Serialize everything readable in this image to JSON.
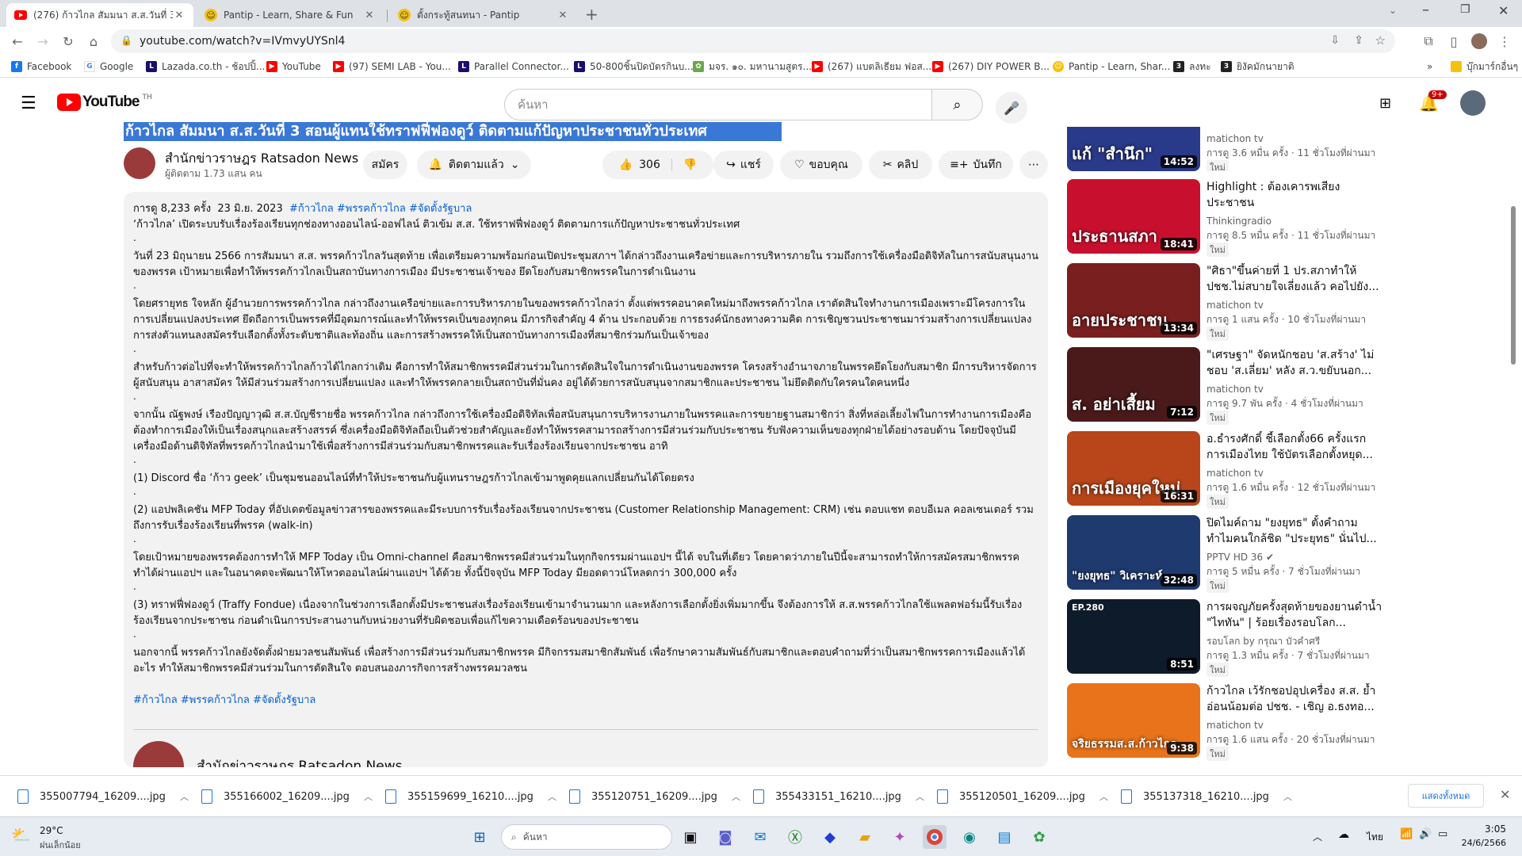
{
  "browser": {
    "tabs": [
      {
        "title": "(276) ก้าวไกล สัมมนา ส.ส.วันที่ 3 สอน",
        "active": true
      },
      {
        "title": "Pantip - Learn, Share & Fun",
        "active": false
      },
      {
        "title": "ตั้งกระทู้สนทนา - Pantip",
        "active": false
      }
    ],
    "new_tab": "+",
    "url": "youtube.com/watch?v=IVmvyUYSnl4",
    "bookmarks": [
      "Facebook",
      "Google",
      "Lazada.co.th - ช้อปปิ้...",
      "YouTube",
      "(97) SEMI LAB - You...",
      "Parallel Connector...",
      "50-800ชิ้นปิดบัตรกินบ...",
      "มจร. ๑๐. มหานามสูตร...",
      "(267) แบตลิเธียม ฟอส...",
      "(267) DIY POWER B...",
      "Pantip - Learn, Shar...",
      "ลงทะ",
      "ยิงัคมักนายาติ"
    ],
    "bookmarks_more": "»",
    "bookmarks_folder": "บุ๊กมาร์กอื่นๆ"
  },
  "youtube": {
    "logo": "YouTube",
    "logo_country": "TH",
    "search_placeholder": "ค้นหา",
    "notif_count": "9+"
  },
  "video": {
    "title": "ก้าวไกล สัมมนา ส.ส.วันที่ 3 สอนผู้แทนใช้ทราฟฟี่ฟองดูว์ ติดตามแก้ปัญหาประชาชนทั่วประเทศ",
    "channel": "สำนักข่าวราษฎร Ratsadon News",
    "subscribers": "ผู้ติดตาม 1.73 แสน คน",
    "join_label": "สมัคร",
    "subscribed_label": "ติดตามแล้ว",
    "likes": "306",
    "share_label": "แชร์",
    "thanks_label": "ขอบคุณ",
    "clip_label": "คลิป",
    "save_label": "บันทึก"
  },
  "description": {
    "views": "การดู 8,233 ครั้ง",
    "date": "23 มิ.ย. 2023",
    "hashtags_top": "#ก้าวไกล #พรรคก้าวไกล #จัดตั้งรัฐบาล",
    "paragraphs": [
      "‘ก้าวไกล’ เปิดระบบรับเรื่องร้องเรียนทุกช่องทางออนไลน์-ออฟไลน์ ติวเข้ม ส.ส. ใช้ทราฟฟี่ฟองดูว์ ติดตามการแก้ปัญหาประชาชนทั่วประเทศ",
      "วันที่ 23 มิถุนายน 2566 การสัมมนา ส.ส. พรรคก้าวไกลวันสุดท้าย เพื่อเตรียมความพร้อมก่อนเปิดประชุมสภาฯ ได้กล่าวถึงงานเครือข่ายและการบริหารภายใน รวมถึงการใช้เครื่องมือดิจิทัลในการสนับสนุนงานของพรรค เป้าหมายเพื่อทำให้พรรคก้าวไกลเป็นสถาบันทางการเมือง มีประชาชนเจ้าของ ยึดโยงกับสมาชิกพรรคในการดำเนินงาน",
      "โดยศรายุทธ ใจหลัก ผู้อำนวยการพรรคก้าวไกล กล่าวถึงงานเครือข่ายและการบริหารภายในของพรรคก้าวไกลว่า ตั้งแต่พรรคอนาคตใหม่มาถึงพรรคก้าวไกล เราตัดสินใจทำงานการเมืองเพราะมีโครงการในการเปลี่ยนแปลงประเทศ ยึดถือการเป็นพรรคที่มีอุดมการณ์และทำให้พรรคเป็นของทุกคน มีภารกิจสำคัญ 4 ด้าน ประกอบด้วย การธรงค์นักธงทางความคิด การเชิญชวนประชาชนมาร่วมสร้างการเปลี่ยนแปลง การส่งตัวแทนลงสมัครรับเลือกตั้งทั้งระดับชาติและท้องถิ่น และการสร้างพรรคให้เป็นสถาบันทางการเมืองที่สมาชิกร่วมกันเป็นเจ้าของ",
      "สำหรับก้าวต่อไปที่จะทำให้พรรคก้าวไกลก้าวได้ไกลกว่าเดิม คือการทำให้สมาชิกพรรคมีส่วนร่วมในการตัดสินใจในการดำเนินงานของพรรค โครงสร้างอำนาจภายในพรรคยึดโยงกับสมาชิก มีการบริหารจัดการผู้สนับสนุน อาสาสมัคร ให้มีส่วนร่วมสร้างการเปลี่ยนแปลง และทำให้พรรคกลายเป็นสถาบันที่มั่นคง อยู่ได้ด้วยการสนับสนุนจากสมาชิกและประชาชน ไม่ยึดติดกับใครคนใดคนหนึ่ง",
      "จากนั้น ณัฐพงษ์ เรืองปัญญาวุฒิ ส.ส.บัญชีรายชื่อ พรรคก้าวไกล กล่าวถึงการใช้เครื่องมือดิจิทัลเพื่อสนับสนุนการบริหารงานภายในพรรคและการขยายฐานสมาชิกว่า สิ่งที่หล่อเลี้ยงไฟในการทำงานการเมืองคือต้องทำการเมืองให้เป็นเรื่องสนุกและสร้างสรรค์ ซึ่งเครื่องมือดิจิทัลถือเป็นตัวช่วยสำคัญและยังทำให้พรรคสามารถสร้างการมีส่วนร่วมกับประชาชน รับฟังความเห็นของทุกฝ่ายได้อย่างรอบด้าน โดยปัจจุบันมีเครื่องมือด้านดิจิทัลที่พรรคก้าวไกลนำมาใช้เพื่อสร้างการมีส่วนร่วมกับสมาชิกพรรคและรับเรื่องร้องเรียนจากประชาชน อาทิ",
      "(1) Discord ชื่อ ‘ก้าว geek’ เป็นชุมชนออนไลน์ที่ทำให้ประชาชนกับผู้แทนราษฎรก้าวไกลเข้ามาพูดคุยแลกเปลี่ยนกันได้โดยตรง",
      "(2) แอปพลิเคชัน MFP Today ที่อัปเดตข้อมูลข่าวสารของพรรคและมีระบบการรับเรื่องร้องเรียนจากประชาชน (Customer Relationship Management: CRM) เช่น ตอบแชท ตอบอีเมล คอลเซนเตอร์ รวมถึงการรับเรื่องร้องเรียนที่พรรค (walk-in)",
      "โดยเป้าหมายของพรรคต้องการทำให้ MFP Today เป็น Omni-channel คือสมาชิกพรรคมีส่วนร่วมในทุกกิจกรรมผ่านแอปฯ นี้ได้ จบในที่เดียว โดยคาดว่าภายในปีนี้จะสามารถทำให้การสมัครสมาชิกพรรคทำได้ผ่านแอปฯ และในอนาคตจะพัฒนาให้โหวตออนไลน์ผ่านแอปฯ ได้ด้วย ทั้งนี้ปัจจุบัน MFP Today มียอดดาวน์โหลดกว่า 300,000 ครั้ง",
      "(3) ทราฟฟี่ฟองดูว์ (Traffy Fondue) เนื่องจากในช่วงการเลือกตั้งมีประชาชนส่งเรื่องร้องเรียนเข้ามาจำนวนมาก และหลังการเลือกตั้งยิ่งเพิ่มมากขึ้น จึงต้องการให้ ส.ส.พรรคก้าวไกลใช้แพลตฟอร์มนี้รับเรื่องร้องเรียนจากประชาชน ก่อนดำเนินการประสานงานกับหน่วยงานที่รับผิดชอบเพื่อแก้ไขความเดือดร้อนของประชาชน",
      "นอกจากนี้ พรรคก้าวไกลยังจัดตั้งฝ่ายมวลชนสัมพันธ์ เพื่อสร้างการมีส่วนร่วมกับสมาชิกพรรค มีกิจกรรมสมาชิกสัมพันธ์ เพื่อรักษาความสัมพันธ์กับสมาชิกและตอบคำถามที่ว่าเป็นสมาชิกพรรคการเมืองแล้วได้อะไร ทำให้สมาชิกพรรคมีส่วนร่วมในการตัดสินใจ ตอบสนองภารกิจการสร้างพรรคมวลชน"
    ],
    "dot": ".",
    "hashtags_bottom": "#ก้าวไกล #พรรคก้าวไกล #จัดตั้งรัฐบาล",
    "footer_channel": "สำนักข่าวราษฎร Ratsadon News"
  },
  "related": [
    {
      "title_line": "",
      "channel": "matichon tv",
      "stats": "การดู 3.6 หมื่น ครั้ง · 11 ชั่วโมงที่ผ่านมา",
      "badge": "ใหม่",
      "duration": "14:52",
      "overlay": "แก้ \"สำนึก\"",
      "color": "#2a3a8a"
    },
    {
      "title_line": "Highlight : ต้องเคารพเสียงประชาชน",
      "channel": "Thinkingradio",
      "stats": "การดู 8.5 หมื่น ครั้ง · 11 ชั่วโมงที่ผ่านมา",
      "badge": "ใหม่",
      "duration": "18:41",
      "overlay": "ประธานสภา",
      "color": "#c8102e"
    },
    {
      "title_line": "\"ศิธา\"ขึ้นค่ายที่ 1 ปร.สภาทำให้ ปชช.ไม่สบายใจเลี่ยงแล้ว คอไปยัง...",
      "channel": "matichon tv",
      "stats": "การดู 1 แสน ครั้ง · 10 ชั่วโมงที่ผ่านมา",
      "badge": "ใหม่",
      "duration": "13:34",
      "overlay": "อายประชาชน",
      "color": "#7a1f1f"
    },
    {
      "title_line": "\"เศรษฐา\" จัดหนักชอบ 'ส.สร้าง' ไม่ชอบ 'ส.เลี่ยม' หลัง ส.ว.ขยับนอก...",
      "channel": "matichon tv",
      "stats": "การดู 9.7 พัน ครั้ง · 4 ชั่วโมงที่ผ่านมา",
      "badge": "ใหม่",
      "duration": "7:12",
      "overlay": "ส. อย่าเสี้ยม",
      "color": "#4a1a1a"
    },
    {
      "title_line": "อ.ธำรงศักดิ์ ชี้เลือกตั้ง66 ครั้งแรก การเมืองไทย ใช้บัตรเลือกตั้งหยุด...",
      "channel": "matichon tv",
      "stats": "การดู 1.6 หมื่น ครั้ง · 12 ชั่วโมงที่ผ่านมา",
      "badge": "ใหม่",
      "duration": "16:31",
      "overlay": "การเมืองยุคใหม่",
      "color": "#b8461a"
    },
    {
      "title_line": "ปิดไมค์ถาม \"ยงยุทธ\" ตั้งคำถาม ทำไมคนใกล้ชิด \"ประยุทธ\" นั่นไป...",
      "channel": "PPTV HD 36",
      "stats": "การดู 5 หมื่น ครั้ง · 7 ชั่วโมงที่ผ่านมา",
      "badge": "ใหม่",
      "duration": "32:48",
      "overlay": "\"ยงยุทธ\" วิเคราะห์",
      "color": "#1f3a6e"
    },
    {
      "title_line": "การผจญภัยครั้งสุดท้ายของยานดำน้ำ \"ไททัน\" | ร้อยเรื่องรอบโลก...",
      "channel": "รอบโลก by กรุณา บัวคำศรี",
      "stats": "การดู 1.3 หมื่น ครั้ง · 7 ชั่วโมงที่ผ่านมา",
      "badge": "ใหม่",
      "duration": "8:51",
      "overlay": "EP.280",
      "color": "#0d1b2a"
    },
    {
      "title_line": "ก้าวไกล เว้รักชอปอุปเครื่อง ส.ส. ย้ำอ่อนน้อมต่อ ปชช. - เชิญ อ.ธงทอ...",
      "channel": "matichon tv",
      "stats": "การดู 1.6 แสน ครั้ง · 20 ชั่วโมงที่ผ่านมา",
      "badge": "ใหม่",
      "duration": "9:38",
      "overlay": "จริยธรรมส.ส.ก้าวไกล",
      "color": "#e8731a"
    }
  ],
  "downloads": {
    "files": [
      "355007794_16209....jpg",
      "355166002_16209....jpg",
      "355159699_16210....jpg",
      "355120751_16209....jpg",
      "355433151_16210....jpg",
      "355120501_16209....jpg",
      "355137318_16210....jpg"
    ],
    "show_all": "แสดงทั้งหมด"
  },
  "taskbar": {
    "weather_temp": "29°C",
    "weather_desc": "ฝนเล็กน้อย",
    "search_placeholder": "ค้นหา",
    "lang": "ไทย",
    "time": "3:05",
    "date": "24/6/2566"
  }
}
